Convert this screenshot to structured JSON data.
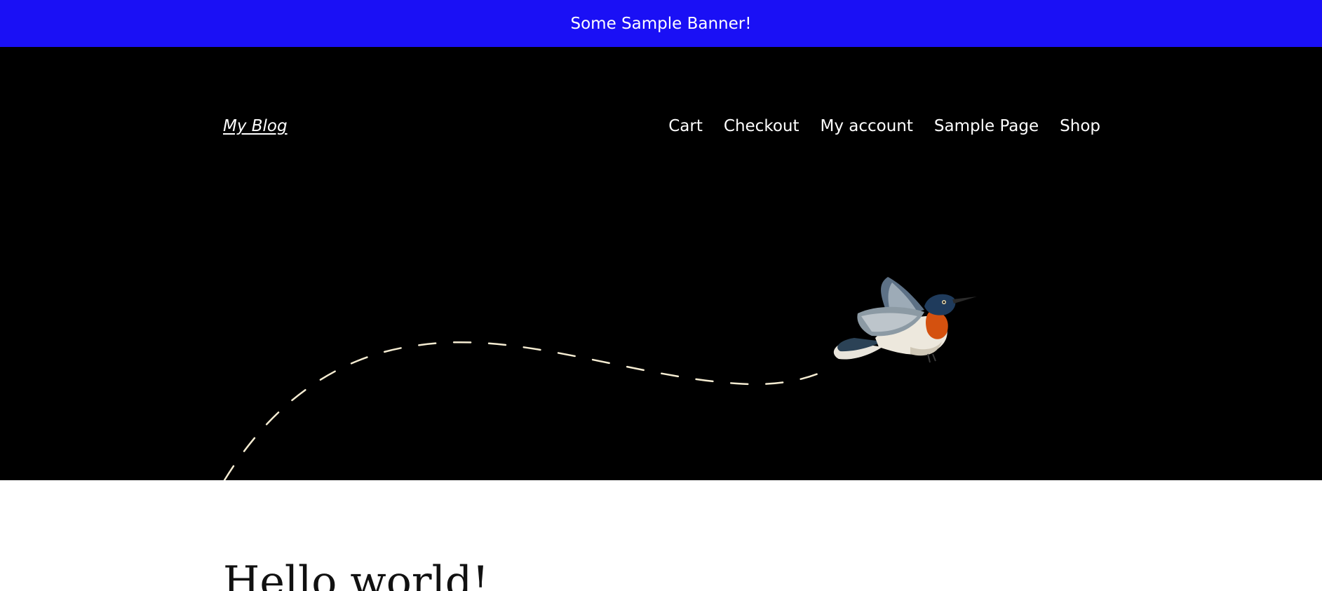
{
  "banner": {
    "text": "Some Sample Banner!"
  },
  "header": {
    "site_title": "My Blog",
    "nav": [
      {
        "label": "Cart"
      },
      {
        "label": "Checkout"
      },
      {
        "label": "My account"
      },
      {
        "label": "Sample Page"
      },
      {
        "label": "Shop"
      }
    ]
  },
  "hero": {
    "image": "hummingbird-flight-path-illustration"
  },
  "post": {
    "title": "Hello world!"
  },
  "colors": {
    "banner_bg": "#1a10f5",
    "hero_bg": "#000000",
    "text_light": "#ffffff",
    "path_stroke": "#f5ecd2"
  }
}
